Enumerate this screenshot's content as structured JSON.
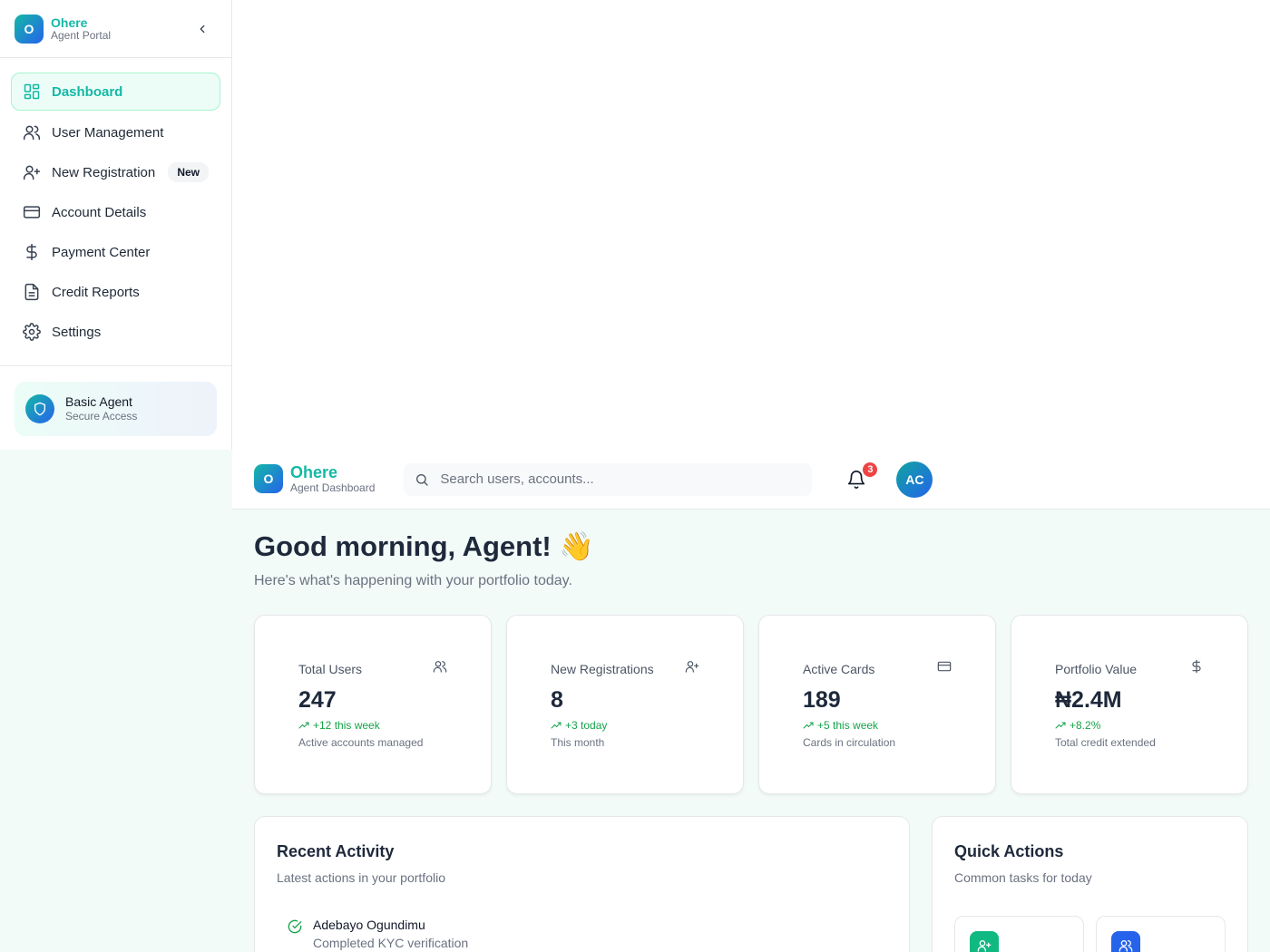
{
  "sidebar": {
    "brand_name": "Ohere",
    "brand_sub": "Agent Portal",
    "logo_letter": "O",
    "items": [
      {
        "label": "Dashboard",
        "icon": "dashboard-icon"
      },
      {
        "label": "User Management",
        "icon": "users-icon"
      },
      {
        "label": "New Registration",
        "icon": "user-plus-icon",
        "badge": "New"
      },
      {
        "label": "Account Details",
        "icon": "credit-card-icon"
      },
      {
        "label": "Payment Center",
        "icon": "dollar-icon"
      },
      {
        "label": "Credit Reports",
        "icon": "document-icon"
      },
      {
        "label": "Settings",
        "icon": "gear-icon"
      }
    ],
    "agent": {
      "name": "Basic Agent",
      "sub": "Secure Access"
    }
  },
  "header": {
    "brand_name": "Ohere",
    "brand_sub": "Agent Dashboard",
    "logo_letter": "O",
    "search_placeholder": "Search users, accounts...",
    "notification_count": "3",
    "avatar_initials": "AC"
  },
  "main": {
    "greeting": "Good morning, Agent! 👋",
    "subtitle": "Here's what's happening with your portfolio today.",
    "stats": [
      {
        "label": "Total Users",
        "value": "247",
        "trend": "+12 this week",
        "desc": "Active accounts managed"
      },
      {
        "label": "New Registrations",
        "value": "8",
        "trend": "+3 today",
        "desc": "This month"
      },
      {
        "label": "Active Cards",
        "value": "189",
        "trend": "+5 this week",
        "desc": "Cards in circulation"
      },
      {
        "label": "Portfolio Value",
        "value": "₦2.4M",
        "trend": "+8.2%",
        "desc": "Total credit extended"
      }
    ],
    "recent_activity": {
      "title": "Recent Activity",
      "subtitle": "Latest actions in your portfolio",
      "items": [
        {
          "name": "Adebayo Ogundimu",
          "desc": "Completed KYC verification"
        }
      ]
    },
    "quick_actions": {
      "title": "Quick Actions",
      "subtitle": "Common tasks for today"
    }
  },
  "colors": {
    "accent": "#14b8a6",
    "accent_blue": "#2563eb",
    "trend_green": "#16a34a",
    "badge_red": "#ef4444"
  }
}
